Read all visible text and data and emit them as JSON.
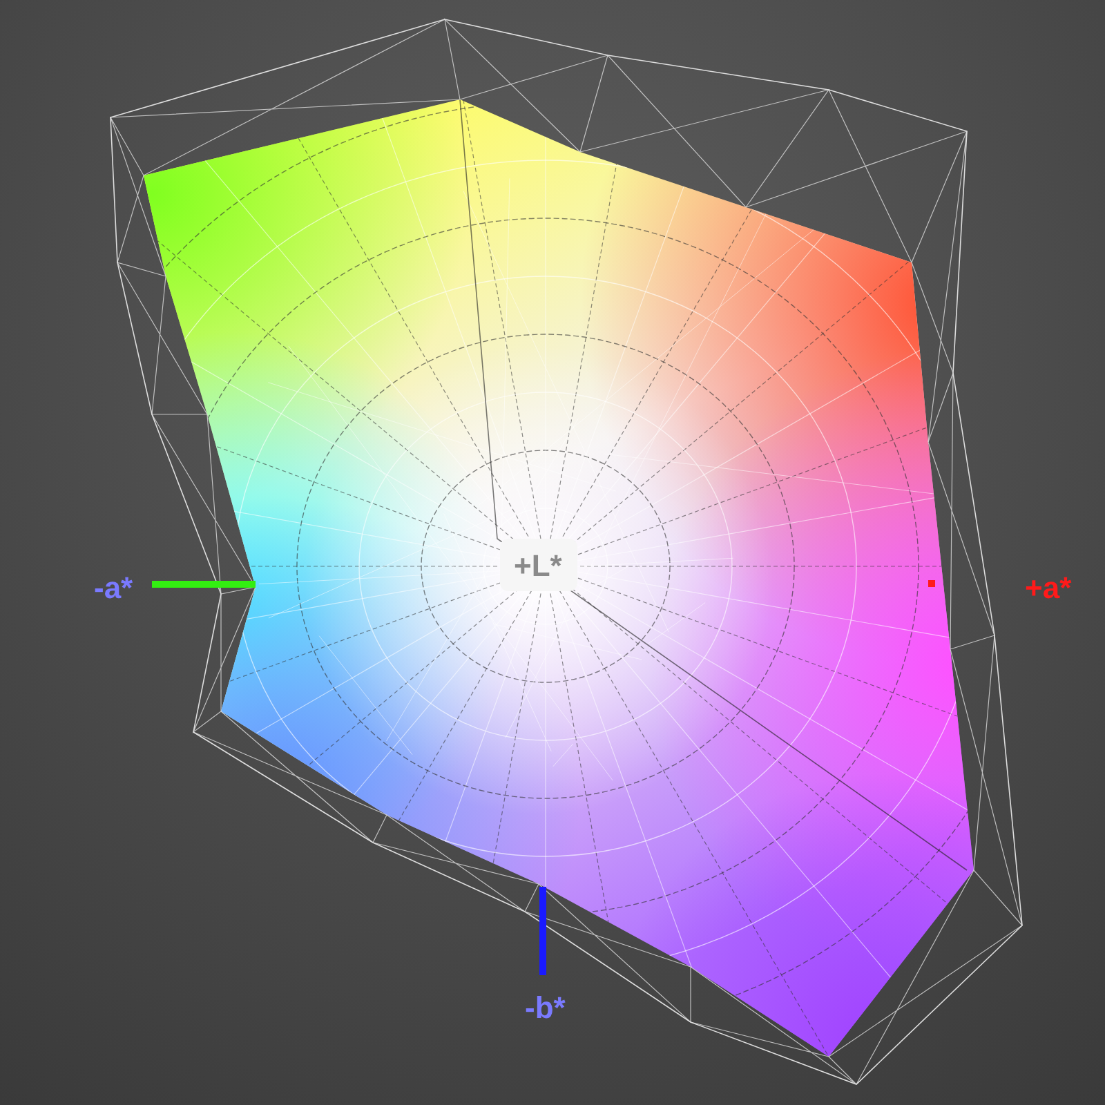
{
  "plot": {
    "axis_labels": [
      {
        "kind": "minus_a",
        "text": "-a*",
        "color": "#7a7aff"
      },
      {
        "kind": "plus_a",
        "text": "+a*",
        "color": "#ff1a1a"
      },
      {
        "kind": "minus_b",
        "text": "-b*",
        "color": "#7a7aff"
      },
      {
        "kind": "plus_l",
        "text": "+L*",
        "color": "#8a8a8a"
      }
    ]
  }
}
